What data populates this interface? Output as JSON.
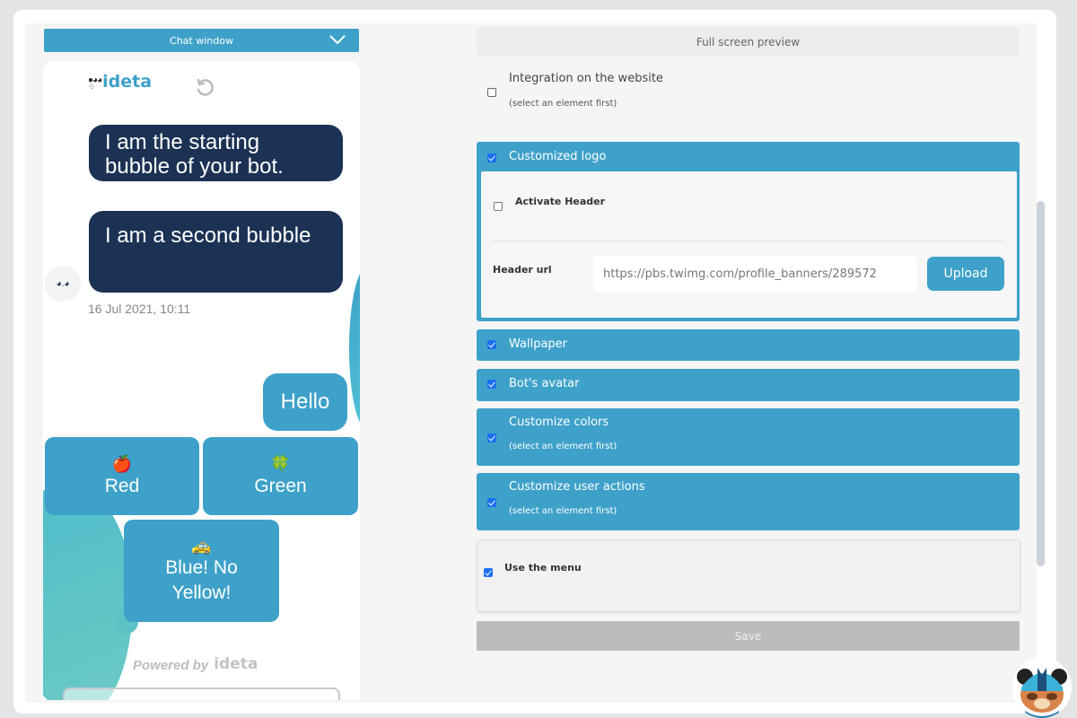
{
  "chat_preview": {
    "selector_label": "Chat window",
    "logo_text": "ideta",
    "messages": [
      {
        "from": "bot",
        "text": "I am the starting bubble of your bot."
      },
      {
        "from": "bot",
        "text": "I am a second bubble"
      }
    ],
    "timestamp": "16 Jul 2021, 10:11",
    "user_message": "Hello",
    "choices": [
      {
        "emoji": "🍎",
        "label": "Red"
      },
      {
        "emoji": "🍀",
        "label": "Green"
      },
      {
        "emoji": "🚕",
        "label": "Blue! No Yellow!"
      }
    ],
    "powered_by": "Powered by",
    "powered_logo": "ideta"
  },
  "settings": {
    "fullscreen_label": "Full screen preview",
    "integration": {
      "label": "Integration on the website",
      "hint": "(select an element first)",
      "checked": false
    },
    "customized_logo": {
      "label": "Customized logo",
      "checked": true,
      "activate_header_label": "Activate Header",
      "activate_header_checked": false,
      "header_url_label": "Header url",
      "header_url_value": "https://pbs.twimg.com/profile_banners/289572",
      "upload_label": "Upload"
    },
    "wallpaper": {
      "label": "Wallpaper",
      "checked": true
    },
    "bots_avatar": {
      "label": "Bot's avatar",
      "checked": true
    },
    "customize_colors": {
      "label": "Customize colors",
      "hint": "(select an element first)",
      "checked": true
    },
    "customize_user_actions": {
      "label": "Customize user actions",
      "hint": "(select an element first)",
      "checked": true
    },
    "use_menu": {
      "label": "Use the menu",
      "checked": true
    },
    "save_label": "Save"
  },
  "colors": {
    "accent": "#3ea1c9",
    "bot_bubble": "#1b3254",
    "save_disabled": "#bcbcbc"
  }
}
